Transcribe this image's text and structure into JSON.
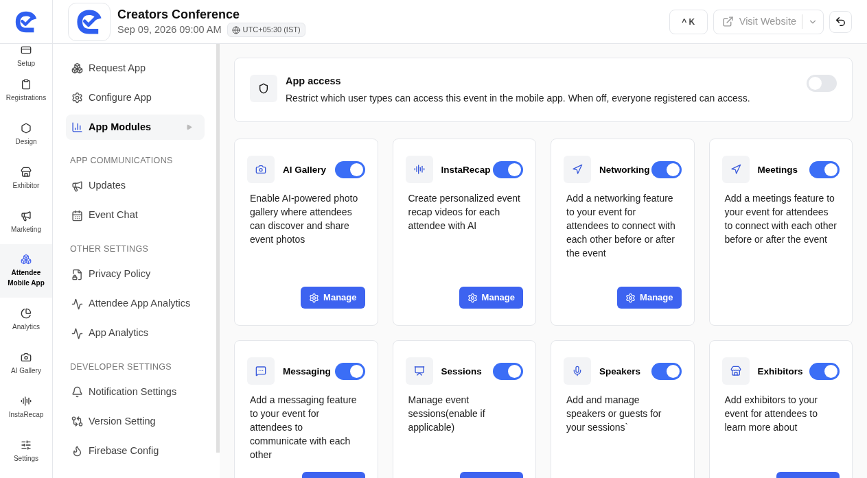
{
  "header": {
    "event_title": "Creators Conference",
    "datetime": "Sep 09, 2026 09:00 AM",
    "timezone": "UTC+05:30 (IST)",
    "shortcut": "^ K",
    "visit_website": "Visit Website"
  },
  "rail": [
    {
      "label": "Setup",
      "selected": false
    },
    {
      "label": "Registrations",
      "selected": false
    },
    {
      "label": "Design",
      "selected": false
    },
    {
      "label": "Exhibitor",
      "selected": false
    },
    {
      "label": "Marketing",
      "selected": false
    },
    {
      "label": "Attendee Mobile App",
      "selected": true
    },
    {
      "label": "Analytics",
      "selected": false
    },
    {
      "label": "AI Gallery",
      "selected": false
    },
    {
      "label": "InstaRecap",
      "selected": false
    },
    {
      "label": "Settings",
      "selected": false
    }
  ],
  "menu": [
    {
      "kind": "item",
      "label": "Request App",
      "selected": false
    },
    {
      "kind": "item",
      "label": "Configure App",
      "selected": false
    },
    {
      "kind": "item",
      "label": "App Modules",
      "selected": true
    },
    {
      "kind": "heading",
      "label": "APP COMMUNICATIONS"
    },
    {
      "kind": "item",
      "label": "Updates",
      "selected": false
    },
    {
      "kind": "item",
      "label": "Event Chat",
      "selected": false
    },
    {
      "kind": "heading",
      "label": "OTHER SETTINGS"
    },
    {
      "kind": "item",
      "label": "Privacy Policy",
      "selected": false
    },
    {
      "kind": "item",
      "label": "Attendee App Analytics",
      "selected": false
    },
    {
      "kind": "item",
      "label": "App Analytics",
      "selected": false
    },
    {
      "kind": "heading",
      "label": "DEVELOPER SETTINGS"
    },
    {
      "kind": "item",
      "label": "Notification Settings",
      "selected": false
    },
    {
      "kind": "item",
      "label": "Version Setting",
      "selected": false
    },
    {
      "kind": "item",
      "label": "Firebase Config",
      "selected": false
    }
  ],
  "app_access": {
    "title": "App access",
    "description": "Restrict which user types can access this event in the mobile app. When off, everyone registered can access.",
    "on": false
  },
  "modules": [
    {
      "title": "AI Gallery",
      "on": true,
      "description": "Enable AI-powered photo gallery where attendees can discover and share event photos",
      "button": "Manage"
    },
    {
      "title": "InstaRecap",
      "on": true,
      "description": "Create personalized event recap videos for each attendee with AI",
      "button": "Manage"
    },
    {
      "title": "Networking",
      "on": true,
      "description": "Add a networking feature to your event for attendees to connect with each other before or after the event",
      "button": "Manage"
    },
    {
      "title": "Meetings",
      "on": true,
      "description": "Add a meetings feature to your event for attendees to connect with each other before or after the event"
    },
    {
      "title": "Messaging",
      "on": true,
      "description": "Add a messaging feature to your event for attendees to communicate with each other",
      "button_cut": true
    },
    {
      "title": "Sessions",
      "on": true,
      "description": "Manage event sessions(enable if applicable)",
      "button_cut": true
    },
    {
      "title": "Speakers",
      "on": true,
      "description": "Add and manage speakers or guests for your sessions`"
    },
    {
      "title": "Exhibitors",
      "on": true,
      "description": "Add exhibitors to your event for attendees to learn more about",
      "button_cut": true
    }
  ]
}
